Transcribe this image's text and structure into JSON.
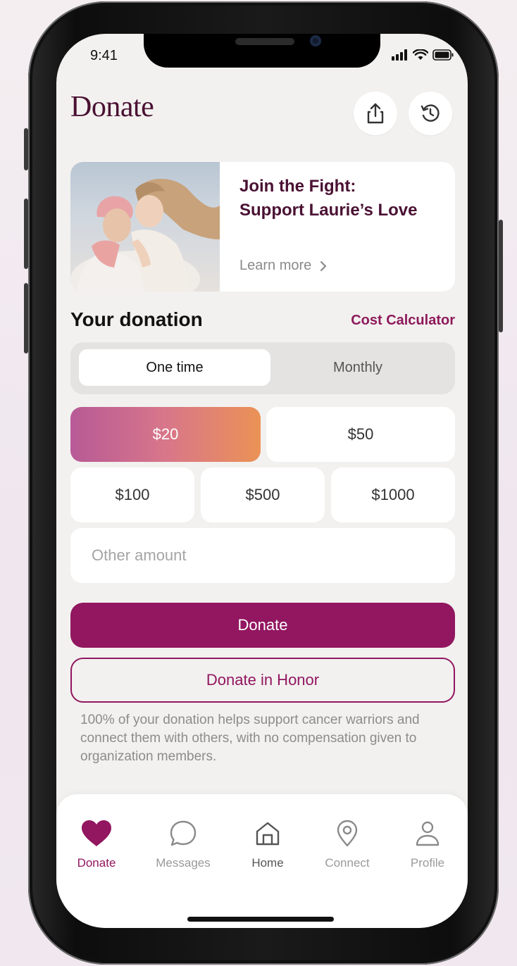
{
  "status_bar": {
    "time": "9:41"
  },
  "header": {
    "title": "Donate"
  },
  "promo": {
    "title_line1": "Join the Fight:",
    "title_line2": "Support Laurie’s Love",
    "link_label": "Learn more"
  },
  "donation": {
    "section_title": "Your donation",
    "calculator_link": "Cost Calculator",
    "frequency": {
      "options": [
        "One time",
        "Monthly"
      ],
      "selected": "One time"
    },
    "amounts": [
      "$20",
      "$50",
      "$100",
      "$500",
      "$1000"
    ],
    "selected_amount": "$20",
    "other_placeholder": "Other amount",
    "donate_label": "Donate",
    "honor_label": "Donate in Honor",
    "disclaimer": "100% of your donation helps support cancer warriors and connect them with others, with no compensation given to organization members."
  },
  "tabbar": {
    "items": [
      {
        "label": "Donate",
        "icon": "heart-icon"
      },
      {
        "label": "Messages",
        "icon": "chat-bubble-icon"
      },
      {
        "label": "Home",
        "icon": "home-icon"
      },
      {
        "label": "Connect",
        "icon": "location-pin-icon"
      },
      {
        "label": "Profile",
        "icon": "person-icon"
      }
    ],
    "active": "Donate"
  },
  "colors": {
    "brand": "#921660",
    "title": "#4a1133",
    "gradient_start": "#b75a96",
    "gradient_end": "#eb9256"
  }
}
